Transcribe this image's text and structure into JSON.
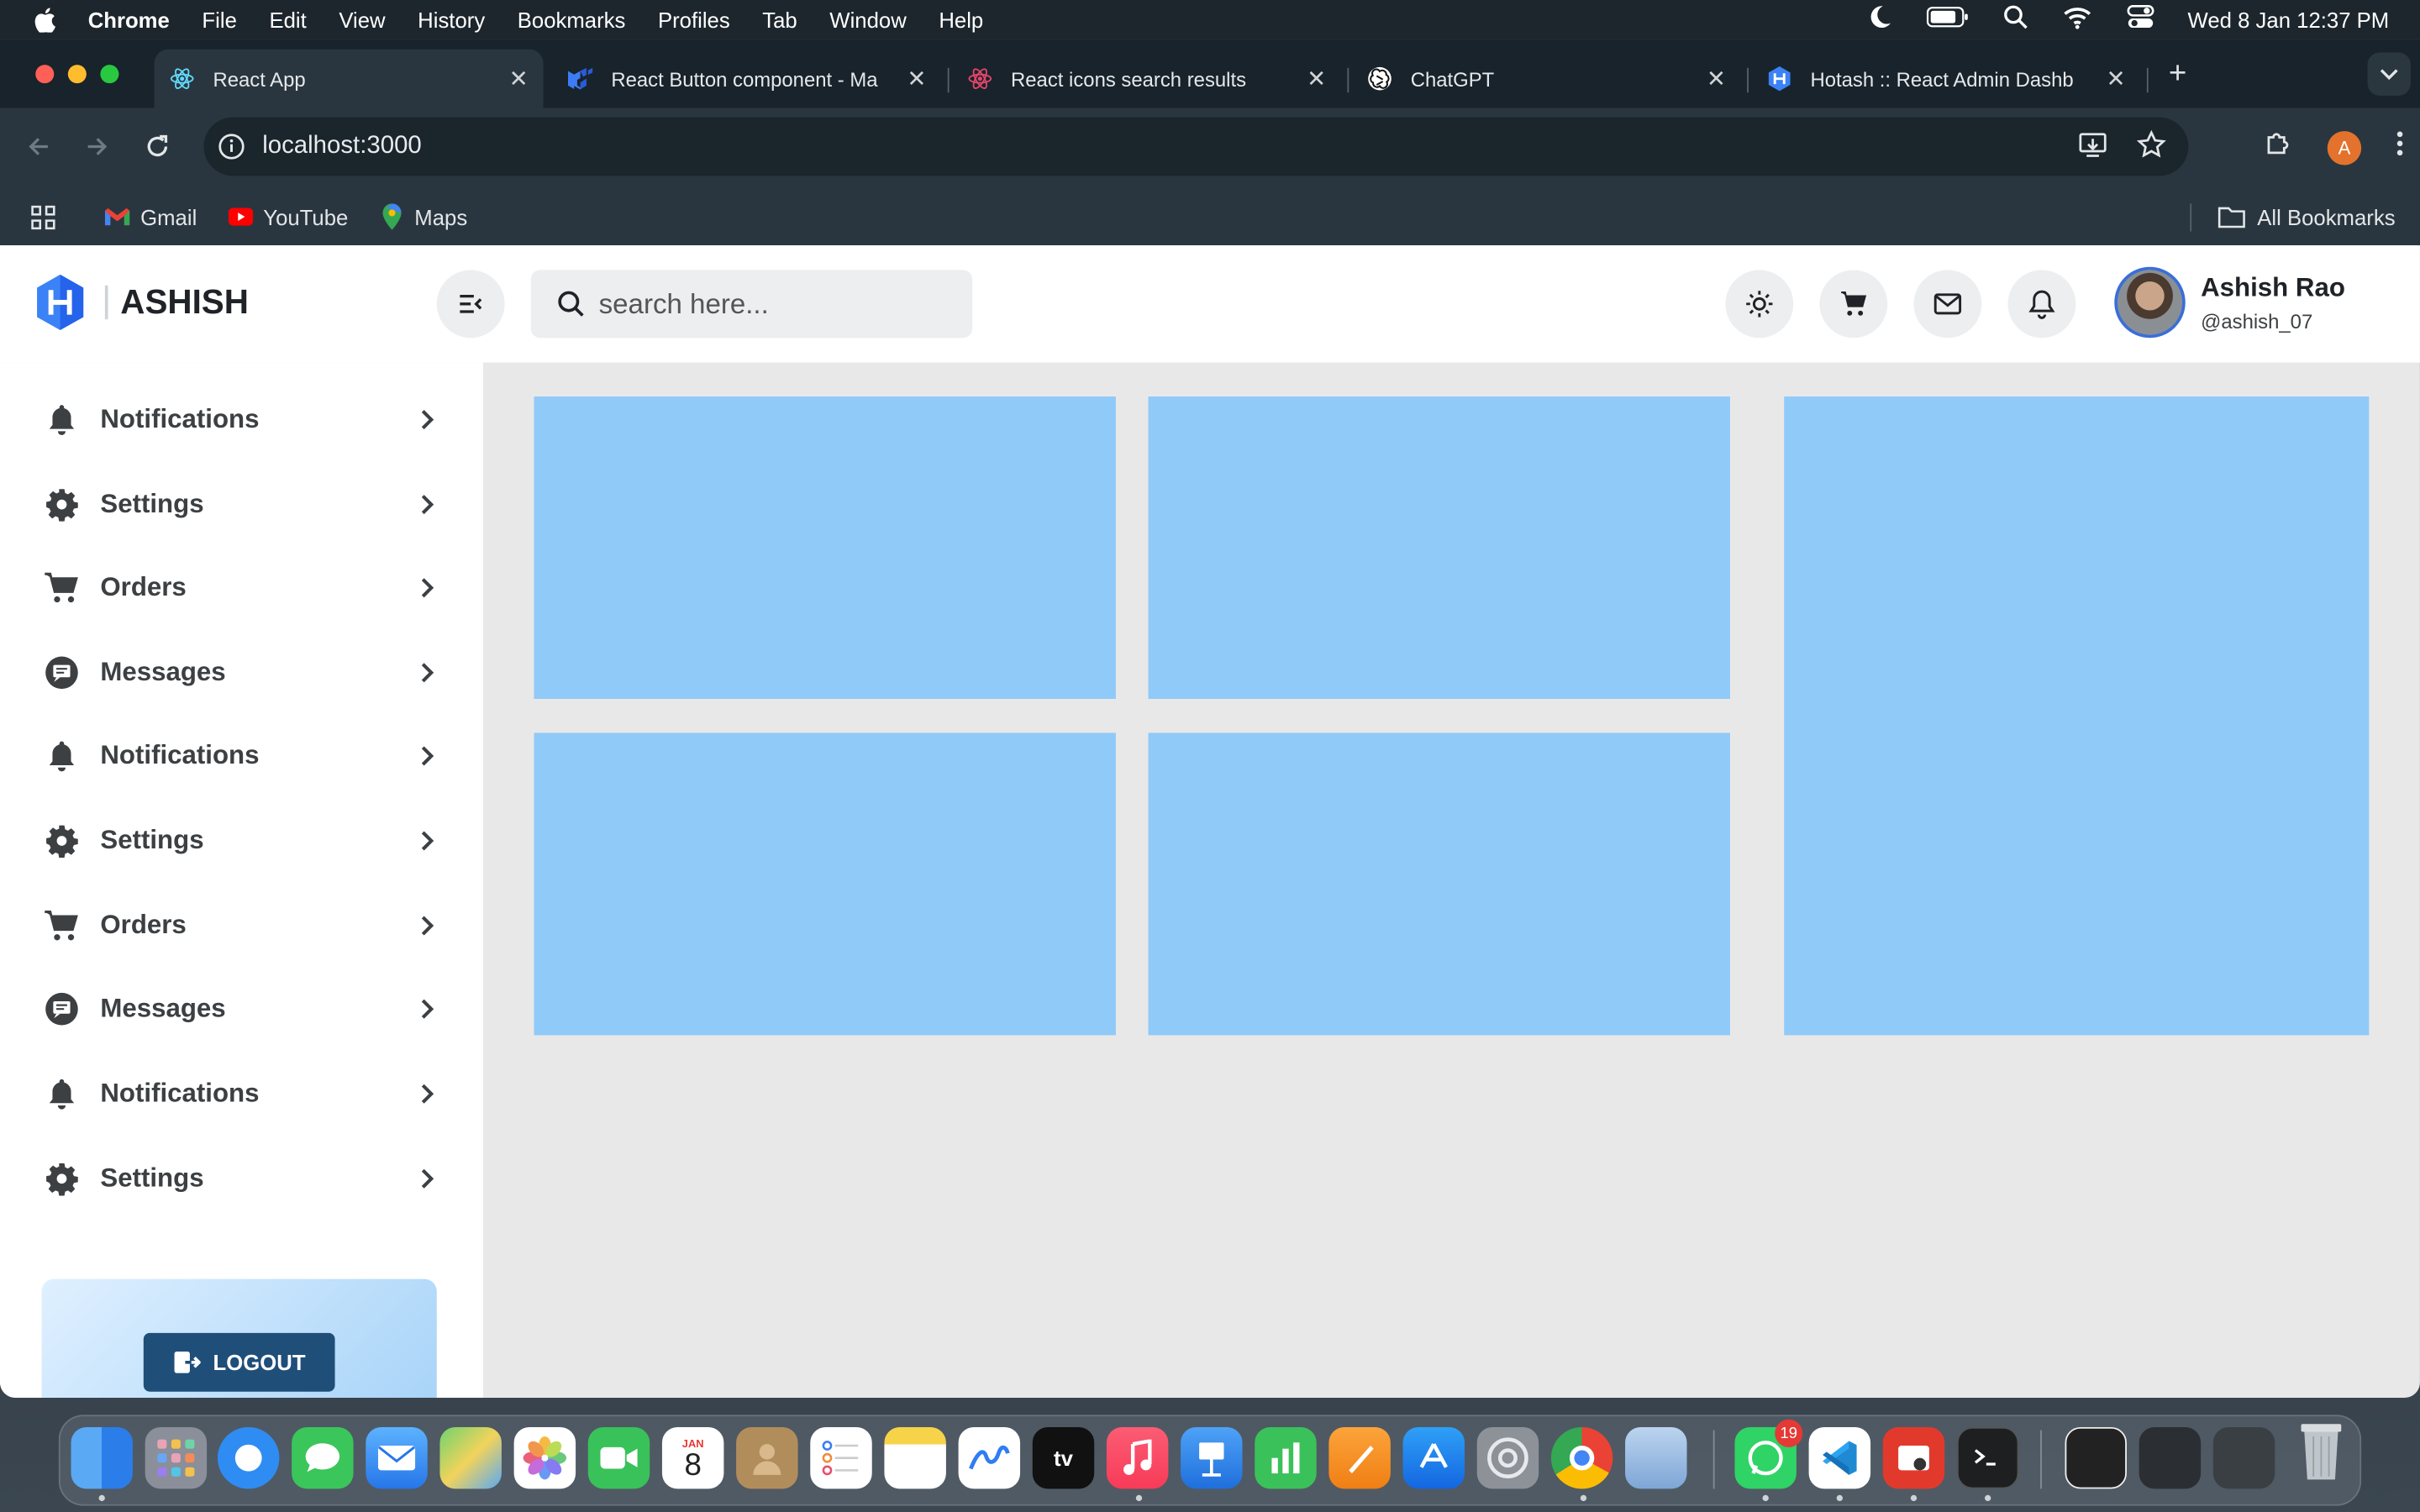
{
  "menubar": {
    "app": "Chrome",
    "items": [
      "File",
      "Edit",
      "View",
      "History",
      "Bookmarks",
      "Profiles",
      "Tab",
      "Window",
      "Help"
    ],
    "clock": "Wed 8 Jan  12:37 PM"
  },
  "browser": {
    "tabs": [
      {
        "label": "React App",
        "active": true
      },
      {
        "label": "React Button component - Ma",
        "active": false
      },
      {
        "label": "React icons search results",
        "active": false
      },
      {
        "label": "ChatGPT",
        "active": false
      },
      {
        "label": "Hotash :: React Admin Dashb",
        "active": false
      }
    ],
    "url": "localhost:3000",
    "profile_initial": "A",
    "bookmarks": [
      "Gmail",
      "YouTube",
      "Maps"
    ],
    "all_bookmarks": "All Bookmarks"
  },
  "app": {
    "brand": "ASHISH",
    "search_placeholder": "search here...",
    "user": {
      "name": "Ashish Rao",
      "handle": "@ashish_07"
    },
    "sidebar": [
      {
        "label": "Notifications",
        "icon": "bell-icon"
      },
      {
        "label": "Settings",
        "icon": "gear-icon"
      },
      {
        "label": "Orders",
        "icon": "cart-icon"
      },
      {
        "label": "Messages",
        "icon": "message-icon"
      },
      {
        "label": "Notifications",
        "icon": "bell-icon"
      },
      {
        "label": "Settings",
        "icon": "gear-icon"
      },
      {
        "label": "Orders",
        "icon": "cart-icon"
      },
      {
        "label": "Messages",
        "icon": "message-icon"
      },
      {
        "label": "Notifications",
        "icon": "bell-icon"
      },
      {
        "label": "Settings",
        "icon": "gear-icon"
      }
    ],
    "logout": "LOGOUT",
    "card_color": "#90caf9"
  },
  "dock": {
    "calendar_month": "JAN",
    "calendar_day": "8",
    "whatsapp_badge": "19"
  }
}
